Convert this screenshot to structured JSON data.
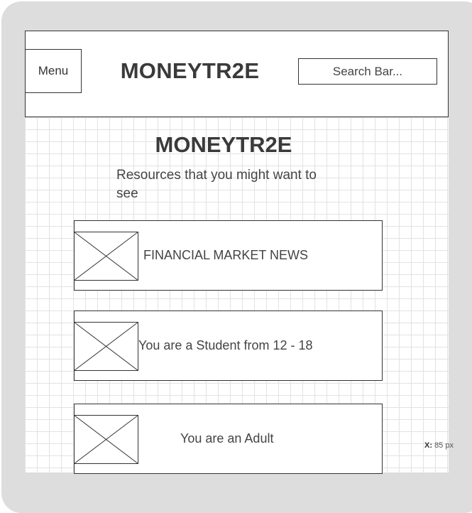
{
  "header": {
    "menu_label": "Menu",
    "title": "MONEYTR2E",
    "search_placeholder": "Search Bar..."
  },
  "main": {
    "title": "MONEYTR2E",
    "subtitle": "Resources that you might want to see",
    "cards": [
      {
        "label": "FINANCIAL MARKET NEWS"
      },
      {
        "label": "You are a Student from 12 - 18"
      },
      {
        "label": "You are an Adult"
      }
    ]
  },
  "status": {
    "coord_label": "X:",
    "coord_value": "85 px"
  }
}
